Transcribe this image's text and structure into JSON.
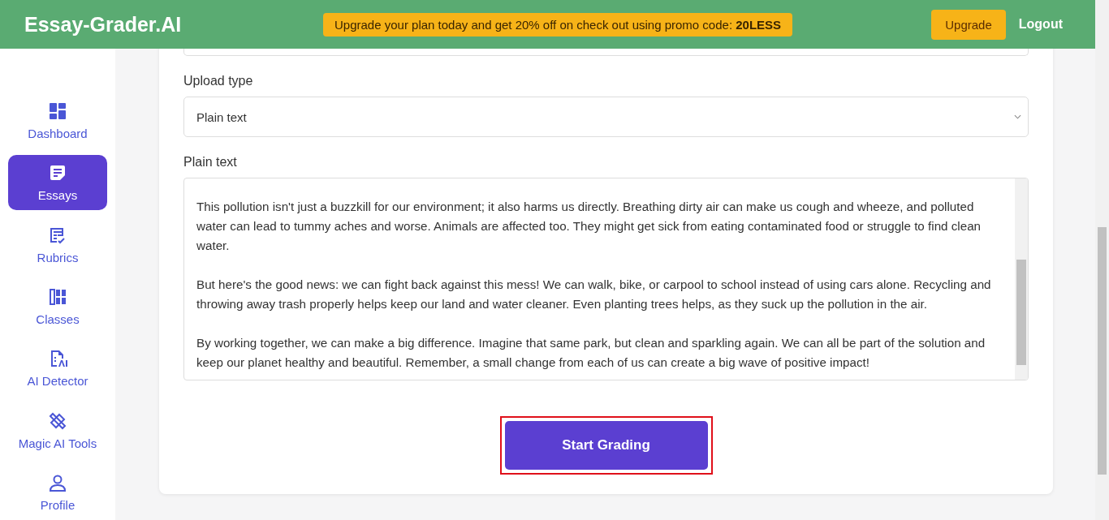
{
  "header": {
    "logo": "Essay-Grader.AI",
    "promo": "Upgrade your plan today and get 20% off on check out using promo code: **20LESS**",
    "buttons": [
      {
        "kind": "upgrade",
        "label": "Upgrade"
      },
      {
        "kind": "logout",
        "label": "Logout"
      }
    ]
  },
  "sidebar": {
    "items": [
      {
        "kind": "dashboard",
        "label": "Dashboard",
        "selected": false
      },
      {
        "kind": "essays",
        "label": "Essays",
        "selected": true
      },
      {
        "kind": "rubrics",
        "label": "Rubrics",
        "selected": false
      },
      {
        "kind": "classes",
        "label": "Classes",
        "selected": false
      },
      {
        "kind": "detector",
        "label": "AI Detector",
        "selected": false
      },
      {
        "kind": "magic",
        "label": "Magic AI Tools",
        "selected": false
      },
      {
        "kind": "profile",
        "label": "Profile",
        "selected": false
      }
    ]
  },
  "form": {
    "fields": [
      {
        "kind": "select",
        "label": "Upload type",
        "value": "Plain text"
      },
      {
        "kind": "textarea",
        "label": "Plain text",
        "paragraphs": [
          "This pollution isn't just a buzzkill for our environment; it also harms us directly. Breathing dirty air can make us cough and wheeze, and polluted water can lead to tummy aches and worse. Animals are affected too. They might get sick from eating contaminated food or struggle to find clean water.",
          "But here's the good news: we can fight back against this mess! We can walk, bike, or carpool to school instead of using cars alone. Recycling and throwing away trash properly helps keep our land and water cleaner. Even planting trees helps, as they suck up the pollution in the air.",
          "By working together, we can make a big difference. Imagine that same park, but clean and sparkling again. We can all be part of the solution and keep our planet healthy and beautiful. Remember, a small change from each of us can create a big wave of positive impact!"
        ]
      }
    ],
    "submit": {
      "label": "Start Grading",
      "highlighted": true
    }
  }
}
